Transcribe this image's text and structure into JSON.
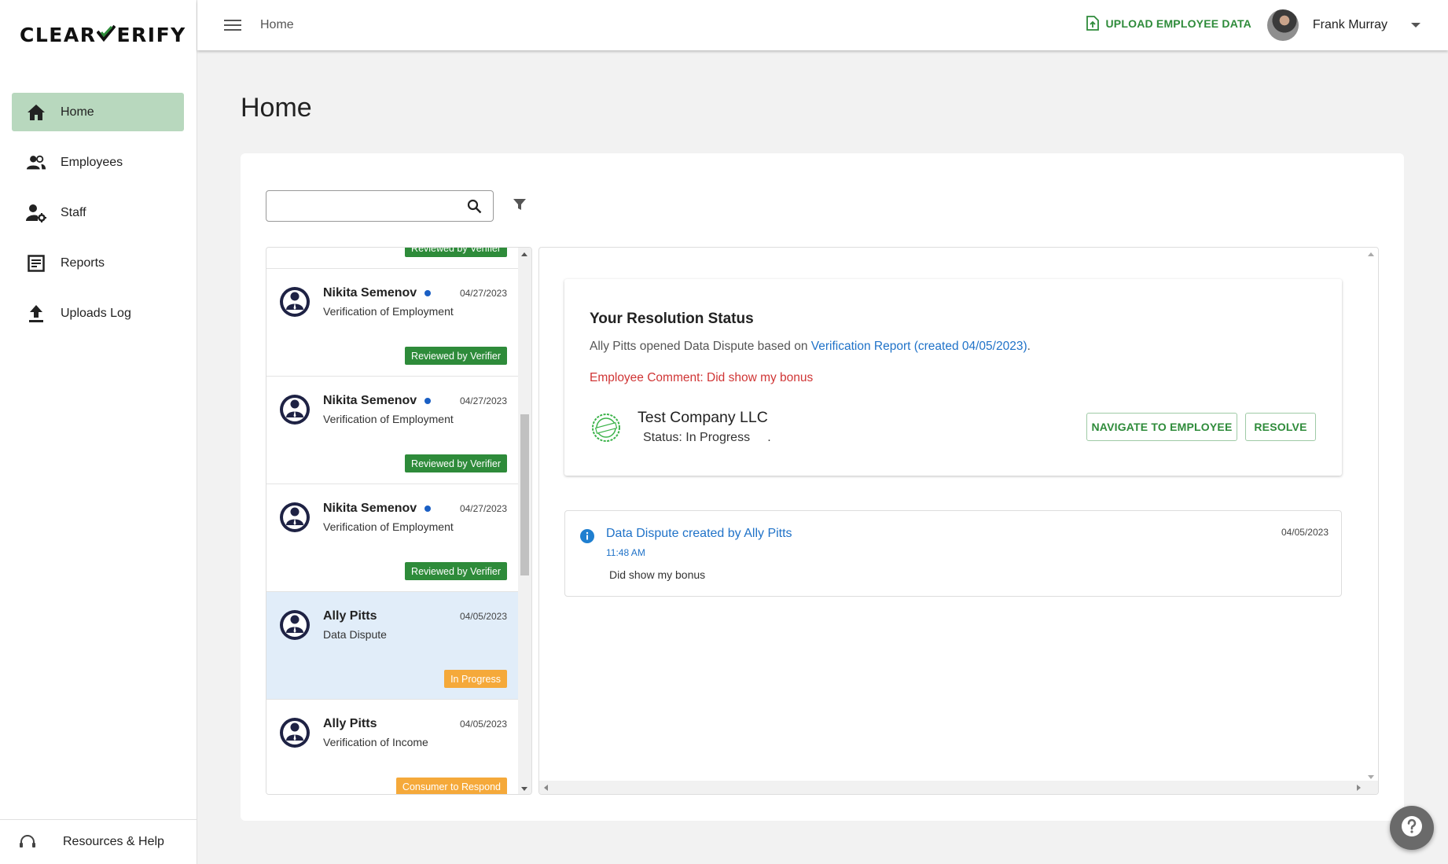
{
  "brand": {
    "logo_left": "CLEAR",
    "logo_right": "ERIFY"
  },
  "sidebar": {
    "items": [
      {
        "label": "Home",
        "icon": "home-icon",
        "active": true
      },
      {
        "label": "Employees",
        "icon": "people-icon"
      },
      {
        "label": "Staff",
        "icon": "staff-gear-icon"
      },
      {
        "label": "Reports",
        "icon": "report-icon"
      },
      {
        "label": "Uploads Log",
        "icon": "upload-icon"
      }
    ],
    "footer_label": "Resources & Help"
  },
  "topbar": {
    "breadcrumb": "Home",
    "upload_label": "UPLOAD EMPLOYEE DATA",
    "user_name": "Frank Murray"
  },
  "page": {
    "title": "Home"
  },
  "search": {
    "placeholder": "",
    "value": ""
  },
  "list": {
    "items": [
      {
        "name": "",
        "type": "",
        "date": "",
        "badge": "Reviewed by Verifier",
        "badge_color": "#2e8b3a",
        "unread": false
      },
      {
        "name": "Nikita Semenov",
        "type": "Verification of Employment",
        "date": "04/27/2023",
        "badge": "Reviewed by Verifier",
        "badge_color": "#2e8b3a",
        "unread": true
      },
      {
        "name": "Nikita Semenov",
        "type": "Verification of Employment",
        "date": "04/27/2023",
        "badge": "Reviewed by Verifier",
        "badge_color": "#2e8b3a",
        "unread": true
      },
      {
        "name": "Nikita Semenov",
        "type": "Verification of Employment",
        "date": "04/27/2023",
        "badge": "Reviewed by Verifier",
        "badge_color": "#2e8b3a",
        "unread": true
      },
      {
        "name": "Ally Pitts",
        "type": "Data Dispute",
        "date": "04/05/2023",
        "badge": "In Progress",
        "badge_color": "#f5a93a",
        "unread": false,
        "selected": true
      },
      {
        "name": "Ally Pitts",
        "type": "Verification of Income",
        "date": "04/05/2023",
        "badge": "Consumer to Respond",
        "badge_color": "#f5a93a",
        "unread": false
      }
    ]
  },
  "detail": {
    "title": "Your Resolution Status",
    "intro": "Ally Pitts opened Data Dispute based on ",
    "report_link": "Verification Report (created 04/05/2023)",
    "intro_end": ".",
    "comment": "Employee Comment: Did show my bonus",
    "company": "Test Company LLC",
    "status": "Status: In Progress",
    "status_tail": ".",
    "navigate_label": "NAVIGATE TO EMPLOYEE",
    "resolve_label": "RESOLVE",
    "timeline": {
      "title": "Data Dispute created by Ally Pitts",
      "time": "11:48 AM",
      "body": "Did show my bonus",
      "date": "04/05/2023"
    }
  },
  "colors": {
    "brand_green": "#2e8b3a",
    "active_nav": "#b8d8be",
    "link_blue": "#1f72c8",
    "comment_red": "#d03535",
    "badge_orange": "#f5a93a",
    "selected_row": "#e1edf9"
  }
}
